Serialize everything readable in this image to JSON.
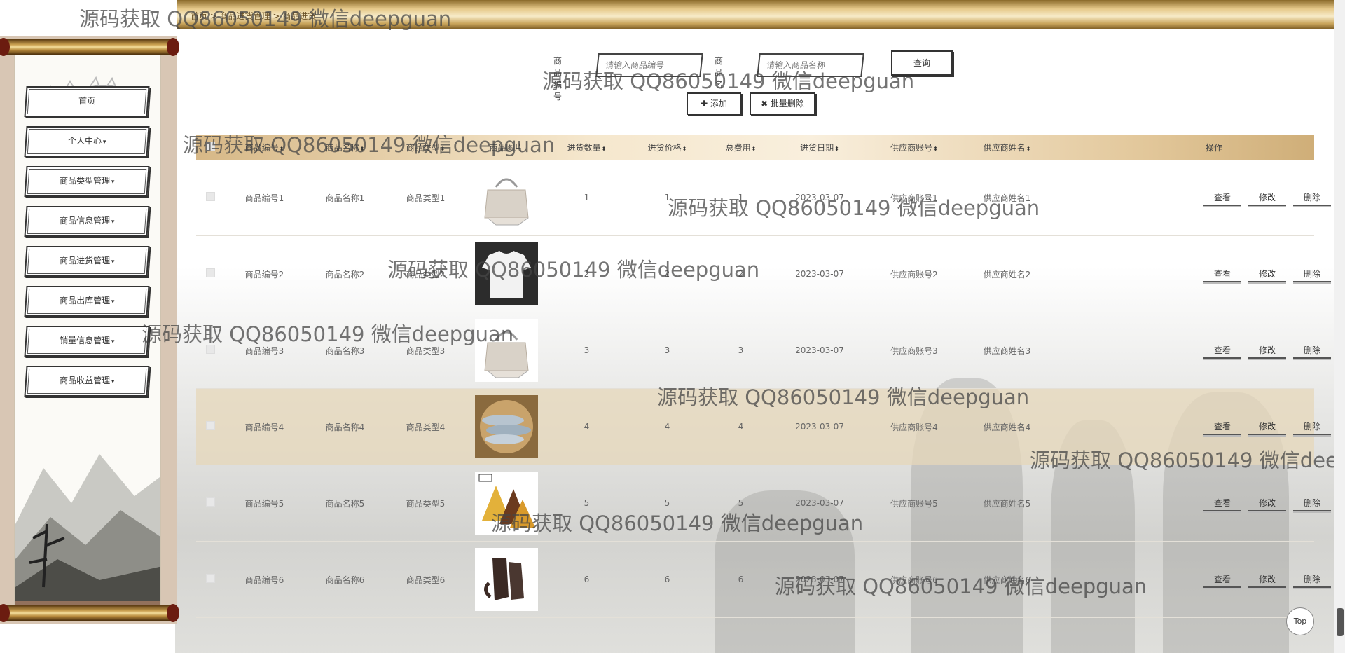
{
  "breadcrumb": "首页 > 商品进货管理 > 商品进货",
  "sidebar": {
    "items": [
      {
        "label": "首页",
        "has_caret": false
      },
      {
        "label": "个人中心",
        "has_caret": true
      },
      {
        "label": "商品类型管理",
        "has_caret": true
      },
      {
        "label": "商品信息管理",
        "has_caret": true
      },
      {
        "label": "商品进货管理",
        "has_caret": true
      },
      {
        "label": "商品出库管理",
        "has_caret": true
      },
      {
        "label": "销量信息管理",
        "has_caret": true
      },
      {
        "label": "商品收益管理",
        "has_caret": true
      }
    ],
    "caret": "▾"
  },
  "search": {
    "code_label": "商品编号",
    "code_placeholder": "请输入商品编号",
    "name_label": "商品名称",
    "name_placeholder": "请输入商品名称",
    "query_button": "查询"
  },
  "toolbar": {
    "add_button": "✚ 添加",
    "batch_delete_button": "✖ 批量删除"
  },
  "table": {
    "columns": [
      "商品编号",
      "商品名称",
      "商品类型",
      "商品图片",
      "进货数量",
      "进货价格",
      "总费用",
      "进货日期",
      "供应商账号",
      "供应商姓名",
      "操作"
    ],
    "sort_icon": "⬍",
    "rows": [
      {
        "code": "商品编号1",
        "name": "商品名称1",
        "type": "商品类型1",
        "image": "bag-icon",
        "qty": "1",
        "price": "1",
        "total": "1",
        "date": "2023-03-07",
        "account": "供应商账号1",
        "supplier": "供应商姓名1"
      },
      {
        "code": "商品编号2",
        "name": "商品名称2",
        "type": "商品类型2",
        "image": "tshirt-icon",
        "qty": "2",
        "price": "2",
        "total": "2",
        "date": "2023-03-07",
        "account": "供应商账号2",
        "supplier": "供应商姓名2"
      },
      {
        "code": "商品编号3",
        "name": "商品名称3",
        "type": "商品类型3",
        "image": "bag-icon",
        "qty": "3",
        "price": "3",
        "total": "3",
        "date": "2023-03-07",
        "account": "供应商账号3",
        "supplier": "供应商姓名3"
      },
      {
        "code": "商品编号4",
        "name": "商品名称4",
        "type": "商品类型4",
        "image": "fish-icon",
        "qty": "4",
        "price": "4",
        "total": "4",
        "date": "2023-03-07",
        "account": "供应商账号4",
        "supplier": "供应商姓名4"
      },
      {
        "code": "商品编号5",
        "name": "商品名称5",
        "type": "商品类型5",
        "image": "chocolate-icon",
        "qty": "5",
        "price": "5",
        "total": "5",
        "date": "2023-03-07",
        "account": "供应商账号5",
        "supplier": "供应商姓名5"
      },
      {
        "code": "商品编号6",
        "name": "商品名称6",
        "type": "商品类型6",
        "image": "gloves-icon",
        "qty": "6",
        "price": "6",
        "total": "6",
        "date": "2023-03-07",
        "account": "供应商账号6",
        "supplier": "供应商姓名6"
      }
    ],
    "actions": {
      "view": "查看",
      "edit": "修改",
      "delete": "删除"
    }
  },
  "watermark_text": "源码获取 QQ86050149 微信deepguan",
  "top_button": "Top",
  "colors": {
    "gold_dark": "#8b6a2a",
    "gold_light": "#f7ebc8",
    "highlight_row": "#e6d7b9"
  }
}
